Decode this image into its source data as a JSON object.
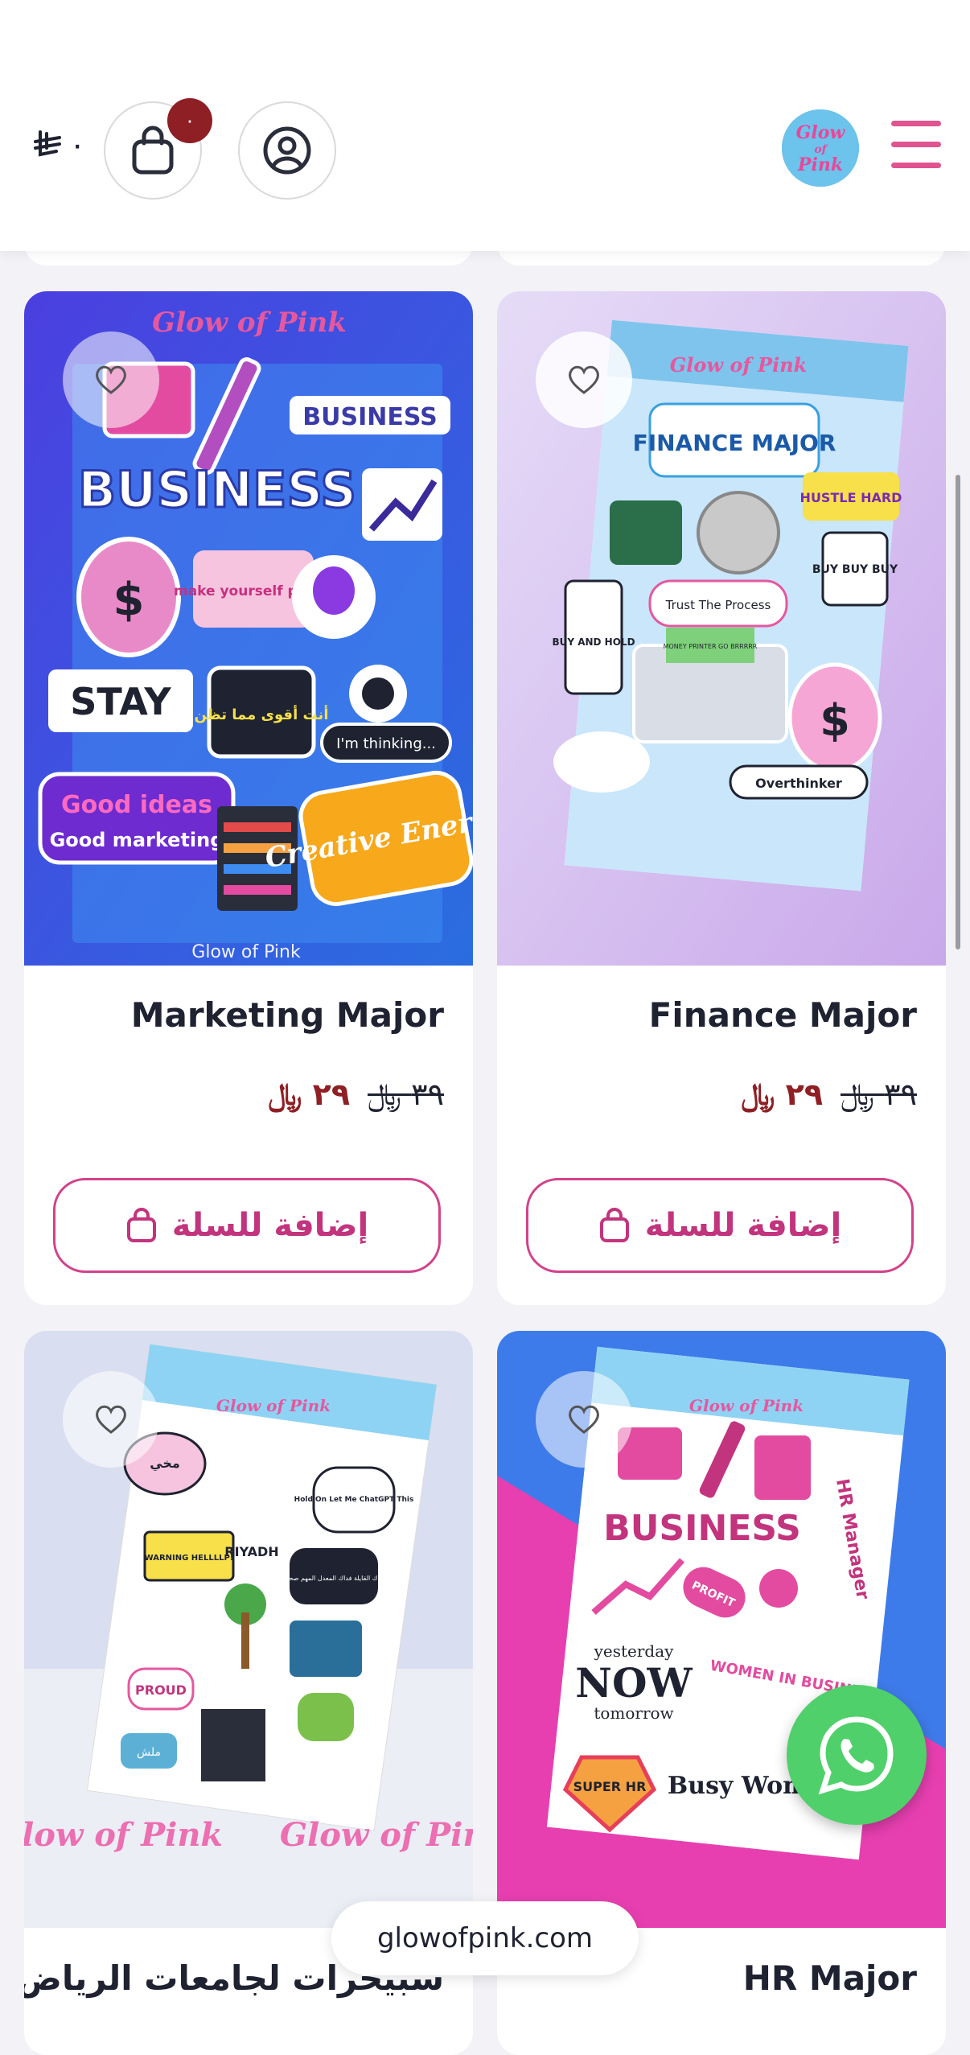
{
  "header": {
    "cart_total": "٠",
    "cart_count": "٠",
    "currency_icon": "riyal-icon",
    "logo_text": "Glow of Pink",
    "cart_icon": "shopping-bag-icon",
    "account_icon": "user-circle-icon",
    "menu_icon": "hamburger-icon"
  },
  "products": [
    {
      "title": "Marketing Major",
      "old_price": "٣٩",
      "new_price": "٢٩",
      "button_label": "إضافة للسلة",
      "image": {
        "sheet_heading": "Glow of Pink",
        "stickers": [
          "BUSINESS",
          "BUSINESS",
          "make yourself proud",
          "STAY",
          "أنت أقوى مما تظن",
          "I'm thinking...",
          "Good ideas",
          "Good marketing",
          "Creative Energy"
        ],
        "footer": "Glow of Pink"
      }
    },
    {
      "title": "Finance Major",
      "old_price": "٣٩",
      "new_price": "٢٩",
      "button_label": "إضافة للسلة",
      "image": {
        "sheet_heading": "Glow of Pink",
        "stickers": [
          "FINANCE MAJOR",
          "HUSTLE HARD",
          "BUY BUY BUY",
          "Trust The Process",
          "BUY AND HOLD",
          "MONEY PRINTER GO BRRRRR",
          "Overthinker"
        ]
      }
    },
    {
      "title": "سبيحرات لجامعات الرياض",
      "image": {
        "sheet_heading": "Glow of Pink",
        "stickers": [
          "مخي",
          "Hold On Let Me ChatGPT This",
          "WARNING HELLLLP!",
          "RIYADH",
          "فداك القايلة فداك المعدل المهم صحتك",
          "PROUD",
          "ملش"
        ],
        "watermark": "Glow of Pink"
      }
    },
    {
      "title": "HR Major",
      "image": {
        "sheet_heading": "Glow of Pink",
        "stickers": [
          "BUSINESS",
          "HR Manager",
          "PROFIT",
          "yesterday",
          "NOW",
          "tomorrow",
          "WOMEN IN BUSINESS",
          "SUPER HR",
          "Busy Woman"
        ]
      }
    }
  ],
  "floating": {
    "whatsapp_icon": "whatsapp-icon",
    "url": "glowofpink.com"
  }
}
